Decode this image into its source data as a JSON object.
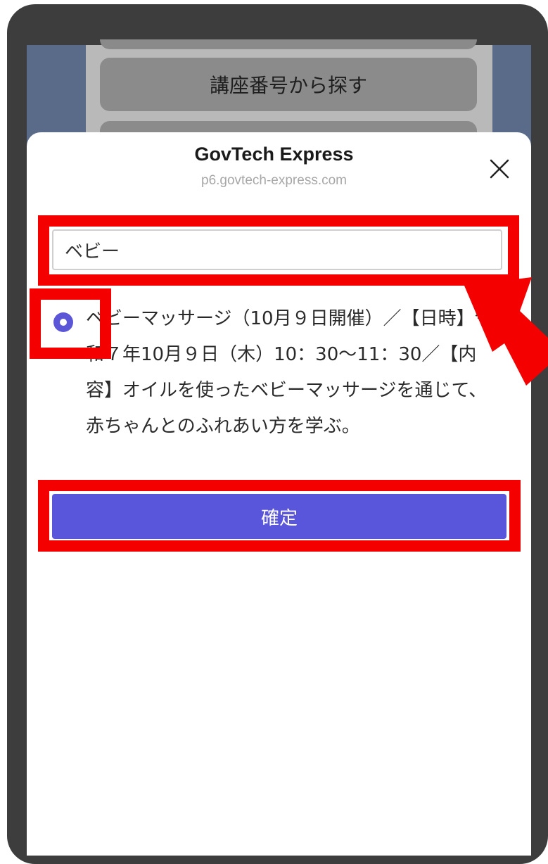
{
  "background": {
    "button_label": "講座番号から探す"
  },
  "sheet": {
    "title": "GovTech Express",
    "url": "p6.govtech-express.com",
    "close_icon": "close-icon"
  },
  "search": {
    "value": "ベビー",
    "placeholder": ""
  },
  "option": {
    "selected": true,
    "text": "ベビーマッサージ（10月９日開催）／【日時】令和７年10月９日（木）10：30〜11：30／【内容】オイルを使ったベビーマッサージを通じて、赤ちゃんとのふれあい方を学ぶ。"
  },
  "confirm": {
    "label": "確定"
  },
  "colors": {
    "accent": "#5a56db",
    "highlight": "#f50000",
    "frame": "#3d3d3d"
  }
}
